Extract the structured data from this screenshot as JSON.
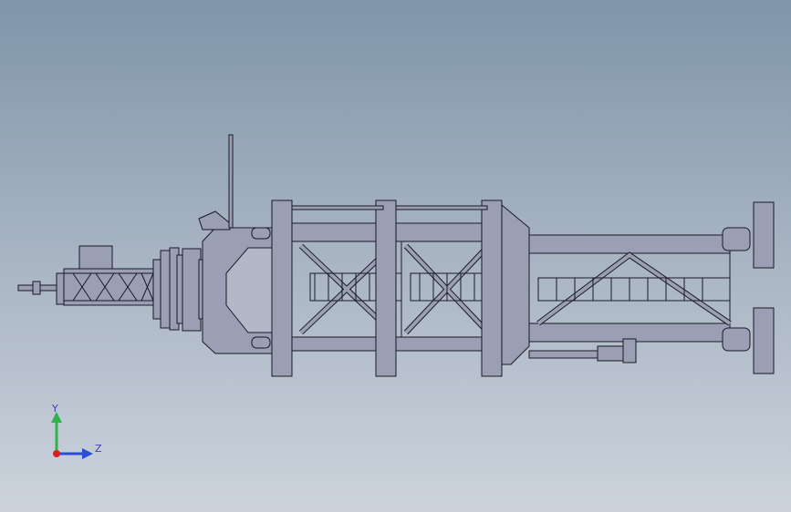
{
  "viewport": {
    "title": "",
    "model_color": "#9a9fb4",
    "edge_color": "#1a1a26",
    "background_top": "#7f95aa",
    "background_bottom": "#ccd3dc"
  },
  "triad": {
    "y_label": "Y",
    "z_label": "Z",
    "y_color": "#2fb34a",
    "z_color": "#2b4ed8",
    "x_color": "#d82020"
  }
}
